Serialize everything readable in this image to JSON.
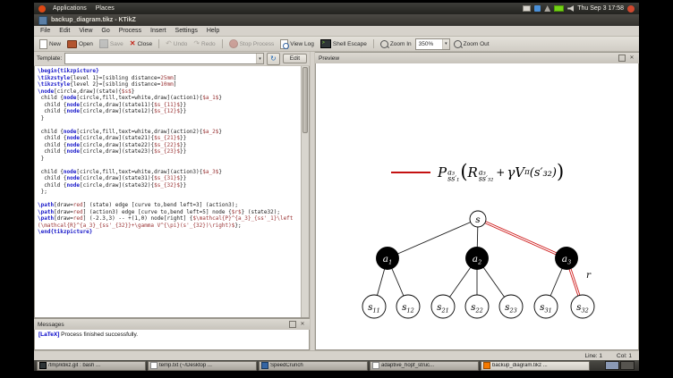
{
  "desktop": {
    "panel": {
      "menus": [
        "Applications",
        "Places"
      ],
      "clock": "Thu Sep 3 17:58"
    },
    "taskbar": {
      "items": [
        {
          "label": "/tmp/ktikz.git : bash ..."
        },
        {
          "label": "temp.txt (~/Desktop ..."
        },
        {
          "label": "SpeedCrunch"
        },
        {
          "label": "adaptive_hopf_struc..."
        },
        {
          "label": "backup_diagram.tikz ..."
        }
      ]
    }
  },
  "window": {
    "title": "backup_diagram.tikz - KTikZ",
    "menubar": [
      "File",
      "Edit",
      "View",
      "Go",
      "Process",
      "Insert",
      "Settings",
      "Help"
    ],
    "toolbar": {
      "new": "New",
      "open": "Open",
      "save": "Save",
      "close": "Close",
      "undo": "Undo",
      "redo": "Redo",
      "stop": "Stop Process",
      "viewlog": "View Log",
      "shell": "Shell Escape",
      "zoomin": "Zoom In",
      "zoom": "350%",
      "zoomout": "Zoom Out"
    },
    "template": {
      "label": "Template:",
      "value": "",
      "edit": "Edit"
    },
    "statusbar": {
      "line": "Line: 1",
      "col": "Col: 1"
    }
  },
  "editor": {
    "lines": [
      [
        [
          "k",
          "\\begin{tikzpicture}"
        ]
      ],
      [
        [
          "k",
          "\\tikzstyle"
        ],
        [
          "p",
          "{level 1}=[sibling distance="
        ],
        [
          "r",
          "25mm"
        ],
        [
          "p",
          "]"
        ]
      ],
      [
        [
          "k",
          "\\tikzstyle"
        ],
        [
          "p",
          "{level 2}=[sibling distance="
        ],
        [
          "r",
          "10mm"
        ],
        [
          "p",
          "]"
        ]
      ],
      [
        [
          "k",
          "\\node"
        ],
        [
          "p",
          "[circle,draw](state){"
        ],
        [
          "r",
          "$s$"
        ],
        [
          "p",
          "}"
        ]
      ],
      [
        [
          "p",
          " child {"
        ],
        [
          "k",
          "node"
        ],
        [
          "p",
          "[circle,fill,text=white,draw](action1){"
        ],
        [
          "r",
          "$a_1$"
        ],
        [
          "p",
          "}"
        ]
      ],
      [
        [
          "p",
          "  child {"
        ],
        [
          "k",
          "node"
        ],
        [
          "p",
          "[circle,draw](state11){"
        ],
        [
          "r",
          "$s_{11}$"
        ],
        [
          "p",
          "}}"
        ]
      ],
      [
        [
          "p",
          "  child {"
        ],
        [
          "k",
          "node"
        ],
        [
          "p",
          "[circle,draw](state12){"
        ],
        [
          "r",
          "$s_{12}$"
        ],
        [
          "p",
          "}}"
        ]
      ],
      [
        [
          "p",
          " }"
        ]
      ],
      [],
      [
        [
          "p",
          " child {"
        ],
        [
          "k",
          "node"
        ],
        [
          "p",
          "[circle,fill,text=white,draw](action2){"
        ],
        [
          "r",
          "$a_2$"
        ],
        [
          "p",
          "}"
        ]
      ],
      [
        [
          "p",
          "  child {"
        ],
        [
          "k",
          "node"
        ],
        [
          "p",
          "[circle,draw](state21){"
        ],
        [
          "r",
          "$s_{21}$"
        ],
        [
          "p",
          "}}"
        ]
      ],
      [
        [
          "p",
          "  child {"
        ],
        [
          "k",
          "node"
        ],
        [
          "p",
          "[circle,draw](state22){"
        ],
        [
          "r",
          "$s_{22}$"
        ],
        [
          "p",
          "}}"
        ]
      ],
      [
        [
          "p",
          "  child {"
        ],
        [
          "k",
          "node"
        ],
        [
          "p",
          "[circle,draw](state23){"
        ],
        [
          "r",
          "$s_{23}$"
        ],
        [
          "p",
          "}}"
        ]
      ],
      [
        [
          "p",
          " }"
        ]
      ],
      [],
      [
        [
          "p",
          " child {"
        ],
        [
          "k",
          "node"
        ],
        [
          "p",
          "[circle,fill,text=white,draw](action3){"
        ],
        [
          "r",
          "$a_3$"
        ],
        [
          "p",
          "}"
        ]
      ],
      [
        [
          "p",
          "  child {"
        ],
        [
          "k",
          "node"
        ],
        [
          "p",
          "[circle,draw](state31){"
        ],
        [
          "r",
          "$s_{31}$"
        ],
        [
          "p",
          "}}"
        ]
      ],
      [
        [
          "p",
          "  child {"
        ],
        [
          "k",
          "node"
        ],
        [
          "p",
          "[circle,draw](state32){"
        ],
        [
          "r",
          "$s_{32}$"
        ],
        [
          "p",
          "}}"
        ]
      ],
      [
        [
          "p",
          " };"
        ]
      ],
      [],
      [
        [
          "k",
          "\\path"
        ],
        [
          "p",
          "[draw="
        ],
        [
          "r",
          "red"
        ],
        [
          "p",
          "] (state) edge [curve to,bend left=3] (action3);"
        ]
      ],
      [
        [
          "k",
          "\\path"
        ],
        [
          "p",
          "[draw="
        ],
        [
          "r",
          "red"
        ],
        [
          "p",
          "] (action3) edge [curve to,bend left=5] node {"
        ],
        [
          "r",
          "$r$"
        ],
        [
          "p",
          "} (state32);"
        ]
      ],
      [
        [
          "k",
          "\\path"
        ],
        [
          "p",
          "[draw="
        ],
        [
          "r",
          "red"
        ],
        [
          "p",
          "] (-2.3,3) -- +(1,0) node[right] {"
        ],
        [
          "r",
          "$\\mathcal{P}^{a_3}_{ss'_1}\\left(\\mathcal{R}^{a_3}_{ss'_{32}}+\\gamma V^{\\pi}(s'_{32})\\right)$"
        ],
        [
          "p",
          "};"
        ]
      ],
      [
        [
          "k",
          "\\end{tikzpicture}"
        ]
      ]
    ]
  },
  "messages": {
    "title": "Messages",
    "badge": "[LaTeX]",
    "text": "Process finished successfully."
  },
  "preview": {
    "title": "Preview",
    "formula": {
      "P": "P",
      "P_sup": "a₃",
      "P_sub": "ss′₁",
      "lparen": "(",
      "R": "R",
      "R_sup": "a₃",
      "R_sub": "ss′₃₂",
      "plus": "+",
      "gammaV": "γV",
      "V_sup": "π",
      "arg": "(s′₃₂)",
      "rparen": ")"
    },
    "tree": {
      "root": "s",
      "edge_label": "r",
      "actions": [
        {
          "base": "a",
          "sub": "1"
        },
        {
          "base": "a",
          "sub": "2"
        },
        {
          "base": "a",
          "sub": "3"
        }
      ],
      "leaves": [
        {
          "base": "s",
          "sub": "11"
        },
        {
          "base": "s",
          "sub": "12"
        },
        {
          "base": "s",
          "sub": "21"
        },
        {
          "base": "s",
          "sub": "22"
        },
        {
          "base": "s",
          "sub": "23"
        },
        {
          "base": "s",
          "sub": "31"
        },
        {
          "base": "s",
          "sub": "32"
        }
      ]
    }
  }
}
